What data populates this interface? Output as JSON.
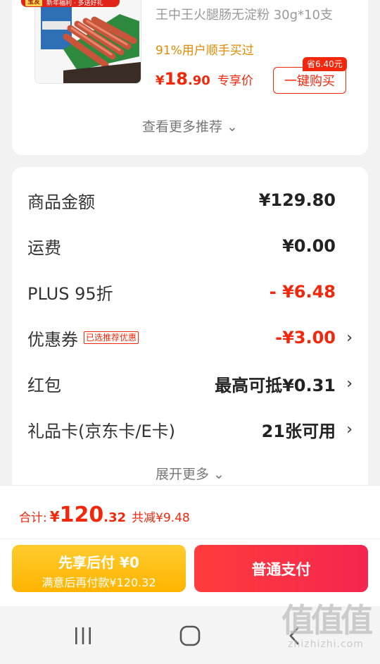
{
  "banner": {
    "badge": "宝友",
    "text": "新年福利 · 多送好礼"
  },
  "recommendation": {
    "product_title": "王中王火腿肠无淀粉 30g*10支",
    "buyers_text": "91%用户顺手买过",
    "price_currency": "¥",
    "price_int": "18",
    "price_dec": ".90",
    "price_tag": "专享价",
    "save_badge": "省6.40元",
    "buy_button": "一键购买",
    "see_more": "查看更多推荐 ⌄"
  },
  "summary": {
    "rows": [
      {
        "label": "商品金额",
        "value": "¥129.80"
      },
      {
        "label": "运费",
        "value": "¥0.00"
      },
      {
        "label": "PLUS 95折",
        "value": "- ¥6.48"
      },
      {
        "label": "优惠券",
        "tag": "已选推荐优惠",
        "value": "-¥3.00"
      },
      {
        "label": "红包",
        "value": "最高可抵¥0.31"
      },
      {
        "label": "礼品卡(京东卡/E卡)",
        "value": "21张可用"
      }
    ],
    "expand_more": "展开更多 ⌄"
  },
  "total": {
    "label": "合计:",
    "currency": "¥",
    "int": "120",
    "dec": ".32",
    "saved": "共减¥9.48"
  },
  "pay": {
    "later_line1": "先享后付 ¥0",
    "later_line2": "满意后再付款¥120.32",
    "pay_button": "普通支付"
  },
  "nav": {
    "icons": [
      "recent-apps-icon",
      "home-icon",
      "back-icon"
    ]
  },
  "watermark": {
    "big": "值值值",
    "small": "zhizhizhi.com"
  },
  "colors": {
    "accent_red": "#f2270c",
    "later_yellow": "#ffb400",
    "buyers_orange": "#e08a00"
  }
}
